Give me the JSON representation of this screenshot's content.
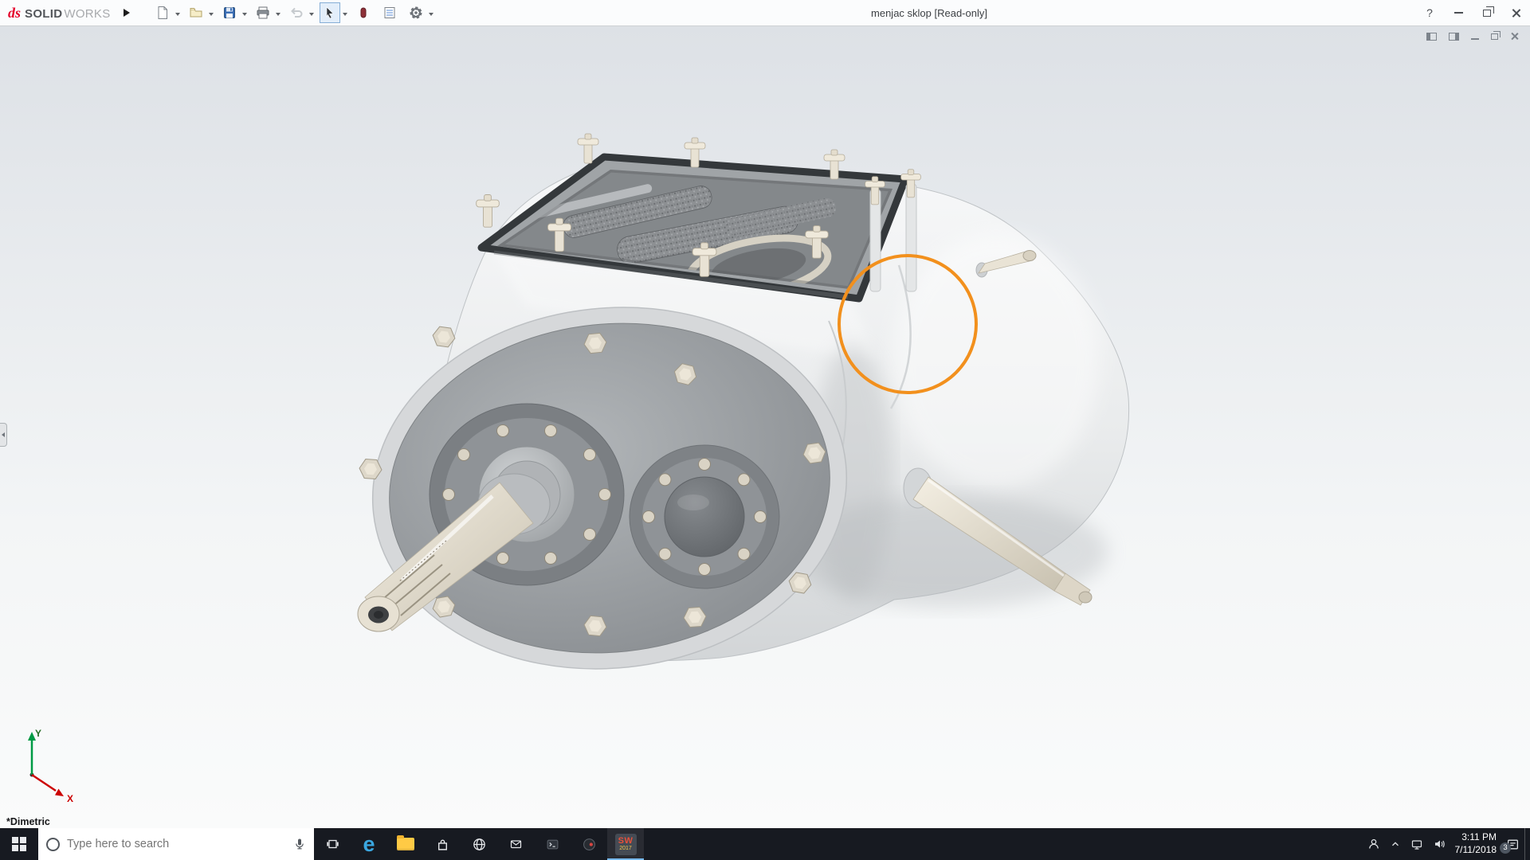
{
  "titlebar": {
    "logo_ds": "ds",
    "logo_solid": "SOLID",
    "logo_works": "WORKS",
    "expander_icon": "play-arrow",
    "toolbar_icons": [
      {
        "name": "new-document",
        "dropdown": true
      },
      {
        "name": "open-document",
        "dropdown": true
      },
      {
        "name": "save",
        "dropdown": true
      },
      {
        "name": "print",
        "dropdown": true
      },
      {
        "name": "undo",
        "dropdown": true,
        "disabled": true
      },
      {
        "name": "select-tool",
        "dropdown": true,
        "active": true
      },
      {
        "name": "xpress-products",
        "dropdown": false
      },
      {
        "name": "file-properties",
        "dropdown": false
      },
      {
        "name": "options-gear",
        "dropdown": true
      }
    ],
    "document_title": "menjac sklop [Read-only]",
    "help_label": "?",
    "window_controls": [
      "minimize-icon",
      "restore-icon",
      "close-icon"
    ]
  },
  "document_window": {
    "controls": [
      "pane-left-icon",
      "pane-right-icon",
      "minimize-icon",
      "restore-icon",
      "close-icon"
    ]
  },
  "viewport": {
    "orientation_label": "*Dimetric",
    "model_name": "gearbox-assembly",
    "annotation_circle_color": "#F2901D",
    "triad": {
      "x_label": "X",
      "y_label": "Y",
      "x_color": "#CC0000",
      "y_color": "#009A44"
    }
  },
  "taskbar": {
    "start_icon": "windows-logo",
    "search_placeholder": "Type here to search",
    "search_icons": [
      "cortana-circle-icon",
      "microphone-icon"
    ],
    "edge_glyph": "e",
    "app_icons": [
      "task-view",
      "edge-browser",
      "file-explorer",
      "microsoft-store",
      "browser-globe",
      "mail",
      "terminal",
      "media-app",
      "solidworks-2017"
    ],
    "solidworks_badge_top": "SW",
    "solidworks_badge_bottom": "2017",
    "tray_icons": [
      "people-icon",
      "hidden-icons-chevron",
      "network-icon",
      "volume-icon",
      "action-center-icon"
    ],
    "clock_time": "3:11 PM",
    "clock_date": "7/11/2018",
    "notification_badge": "3"
  }
}
